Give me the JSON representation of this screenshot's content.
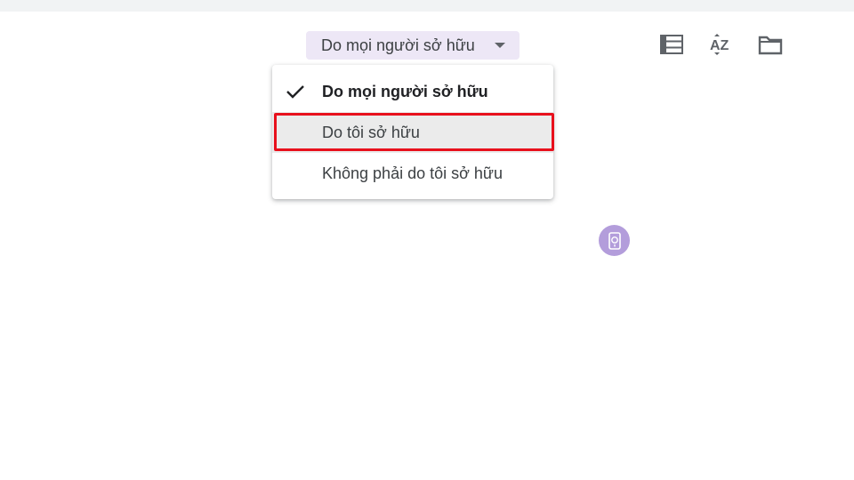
{
  "owner_filter": {
    "label": "Do mọi người sở hữu"
  },
  "toolbar": {
    "icons": [
      "list-view-icon",
      "sort-az-icon",
      "folder-icon"
    ],
    "sort_label": "AZ"
  },
  "menu": {
    "items": [
      {
        "label": "Do mọi người sở hữu",
        "selected": true
      },
      {
        "label": "Do tôi sở hữu",
        "selected": false,
        "highlighted": true
      },
      {
        "label": "Không phải do tôi sở hữu",
        "selected": false
      }
    ]
  },
  "colors": {
    "chip_background": "#ede7f6",
    "highlight_border": "#e8101c",
    "hover_background": "#ebebeb",
    "badge": "#b39ddb"
  }
}
